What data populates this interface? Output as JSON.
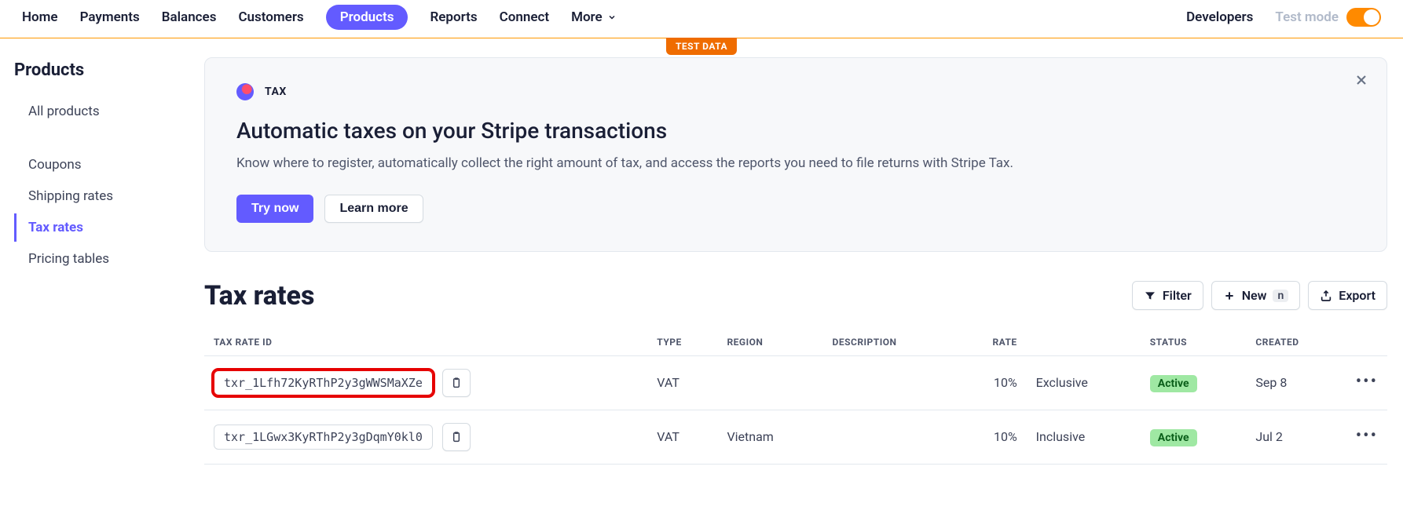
{
  "nav": {
    "items": [
      {
        "label": "Home"
      },
      {
        "label": "Payments"
      },
      {
        "label": "Balances"
      },
      {
        "label": "Customers"
      },
      {
        "label": "Products"
      },
      {
        "label": "Reports"
      },
      {
        "label": "Connect"
      },
      {
        "label": "More"
      }
    ],
    "developers": "Developers",
    "test_mode_label": "Test mode",
    "test_data_badge": "TEST DATA"
  },
  "sidebar": {
    "title": "Products",
    "items": [
      {
        "label": "All products"
      },
      {
        "label": "Coupons"
      },
      {
        "label": "Shipping rates"
      },
      {
        "label": "Tax rates"
      },
      {
        "label": "Pricing tables"
      }
    ]
  },
  "promo": {
    "tag": "TAX",
    "title": "Automatic taxes on your Stripe transactions",
    "desc": "Know where to register, automatically collect the right amount of tax, and access the reports you need to file returns with Stripe Tax.",
    "try_label": "Try now",
    "learn_label": "Learn more"
  },
  "section": {
    "title": "Tax rates",
    "filter_label": "Filter",
    "new_label": "New",
    "new_kbd": "n",
    "export_label": "Export"
  },
  "table": {
    "headers": {
      "id": "TAX RATE ID",
      "type": "TYPE",
      "region": "REGION",
      "description": "DESCRIPTION",
      "rate": "RATE",
      "inclusive": "",
      "status": "STATUS",
      "created": "CREATED"
    },
    "rows": [
      {
        "id": "txr_1Lfh72KyRThP2y3gWWSMaXZe",
        "type": "VAT",
        "region": "",
        "description": "",
        "rate": "10%",
        "inclusive": "Exclusive",
        "status": "Active",
        "created": "Sep 8",
        "highlight": true
      },
      {
        "id": "txr_1LGwx3KyRThP2y3gDqmY0kl0",
        "type": "VAT",
        "region": "Vietnam",
        "description": "",
        "rate": "10%",
        "inclusive": "Inclusive",
        "status": "Active",
        "created": "Jul 2",
        "highlight": false
      }
    ]
  }
}
